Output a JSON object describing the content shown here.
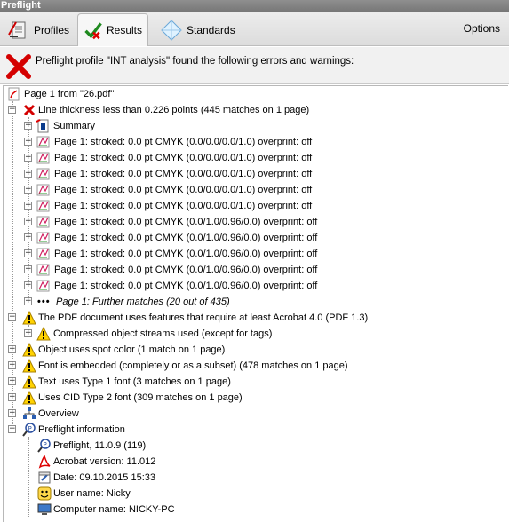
{
  "window": {
    "title": "Preflight"
  },
  "tabs": [
    {
      "label": "Profiles",
      "icon": "profiles-icon"
    },
    {
      "label": "Results",
      "icon": "results-checkmark-icon",
      "active": true
    },
    {
      "label": "Standards",
      "icon": "standards-diamond-icon"
    }
  ],
  "options_label": "Options",
  "header": {
    "message": "Preflight profile \"INT analysis\" found the following errors and warnings:"
  },
  "tree": {
    "root": "Page 1 from \"26.pdf\"",
    "line_thickness": "Line thickness less than 0.226 points (445 matches on 1 page)",
    "summary": "Summary",
    "matches": [
      "Page 1:  stroked: 0.0 pt CMYK (0.0/0.0/0.0/1.0)  overprint: off",
      "Page 1:  stroked: 0.0 pt CMYK (0.0/0.0/0.0/1.0)  overprint: off",
      "Page 1:  stroked: 0.0 pt CMYK (0.0/0.0/0.0/1.0)  overprint: off",
      "Page 1:  stroked: 0.0 pt CMYK (0.0/0.0/0.0/1.0)  overprint: off",
      "Page 1:  stroked: 0.0 pt CMYK (0.0/0.0/0.0/1.0)  overprint: off",
      "Page 1:  stroked: 0.0 pt CMYK (0.0/1.0/0.96/0.0)  overprint: off",
      "Page 1:  stroked: 0.0 pt CMYK (0.0/1.0/0.96/0.0)  overprint: off",
      "Page 1:  stroked: 0.0 pt CMYK (0.0/1.0/0.96/0.0)  overprint: off",
      "Page 1:  stroked: 0.0 pt CMYK (0.0/1.0/0.96/0.0)  overprint: off",
      "Page 1:  stroked: 0.0 pt CMYK (0.0/1.0/0.96/0.0)  overprint: off"
    ],
    "further": "Page 1: Further matches (20 out of 435)",
    "acrobat_features": "The PDF document uses features that require at least Acrobat 4.0 (PDF 1.3)",
    "compressed": "Compressed object streams used (except for tags)",
    "spot_color": "Object uses spot color (1 match on 1 page)",
    "font_embedded": "Font is embedded (completely or as a subset) (478 matches on 1 page)",
    "type1": "Text uses Type 1 font (3 matches on 1 page)",
    "cid": "Uses CID Type 2 font (309 matches on 1 page)",
    "overview": "Overview",
    "preflight_info": "Preflight information",
    "info": {
      "preflight": "Preflight, 11.0.9 (119)",
      "acrobat": "Acrobat version: 11.012",
      "date": "Date: 09.10.2015 15:33",
      "user": "User name: Nicky",
      "computer": "Computer name: NICKY-PC"
    }
  }
}
